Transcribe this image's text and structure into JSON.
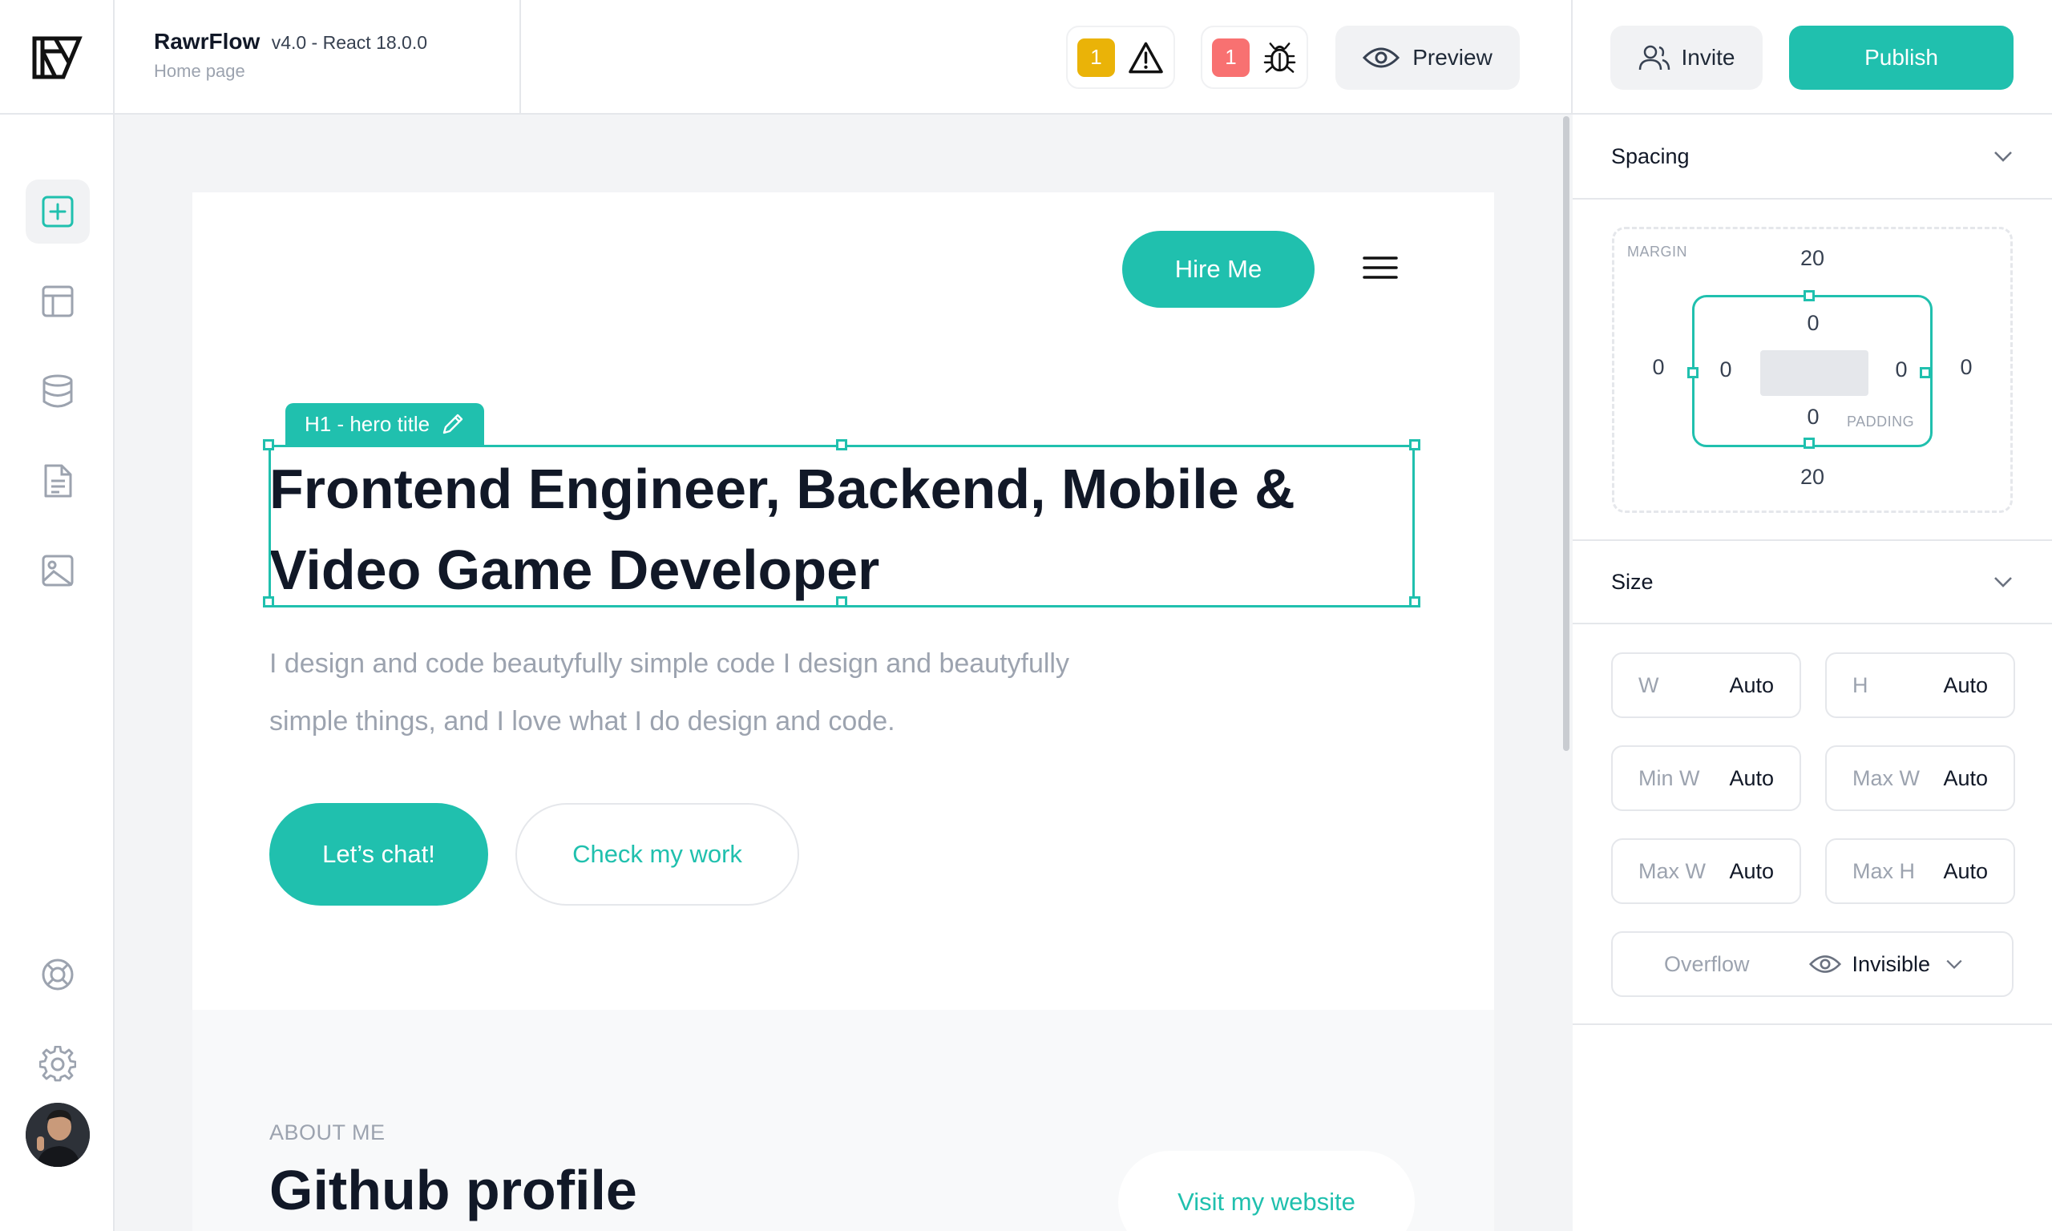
{
  "app": {
    "name": "RawrFlow",
    "version": "v4.0 - React 18.0.0",
    "page": "Home page"
  },
  "toolbar": {
    "warnings_count": "1",
    "errors_count": "1",
    "preview_label": "Preview",
    "invite_label": "Invite",
    "publish_label": "Publish"
  },
  "sidebar": {
    "items": [
      {
        "icon": "add-square-icon",
        "active": true
      },
      {
        "icon": "layout-icon",
        "active": false
      },
      {
        "icon": "database-icon",
        "active": false
      },
      {
        "icon": "document-icon",
        "active": false
      },
      {
        "icon": "image-icon",
        "active": false
      }
    ],
    "bottom": [
      {
        "icon": "help-lifebuoy-icon"
      },
      {
        "icon": "settings-gear-icon"
      }
    ]
  },
  "canvas": {
    "hire_label": "Hire Me",
    "selected_tag": "H1 - hero title",
    "hero_title_line1": "Frontend Engineer, Backend, Mobile &",
    "hero_title_line2": "Video Game Developer",
    "hero_sub_line1": "I design and code beautyfully simple code I design and beautyfully",
    "hero_sub_line2": "simple things, and I love what I do design and code.",
    "chat_label": "Let’s chat!",
    "work_label": "Check my work",
    "about_label": "ABOUT ME",
    "about_title": "Github profile",
    "visit_label": "Visit my website"
  },
  "panel": {
    "spacing_title": "Spacing",
    "margin_label": "MARGIN",
    "padding_label": "PADDING",
    "margin": {
      "top": "20",
      "right": "0",
      "bottom": "20",
      "left": "0"
    },
    "padding": {
      "top": "0",
      "right": "0",
      "bottom": "0",
      "left": "0"
    },
    "size_title": "Size",
    "fields": [
      {
        "label": "W",
        "value": "Auto"
      },
      {
        "label": "H",
        "value": "Auto"
      },
      {
        "label": "Min W",
        "value": "Auto"
      },
      {
        "label": "Max W",
        "value": "Auto"
      },
      {
        "label": "Max W",
        "value": "Auto"
      },
      {
        "label": "Max H",
        "value": "Auto"
      }
    ],
    "overflow_label": "Overflow",
    "overflow_value": "Invisible"
  },
  "colors": {
    "accent": "#20c0ae",
    "warning": "#eab308",
    "error": "#f87171"
  }
}
